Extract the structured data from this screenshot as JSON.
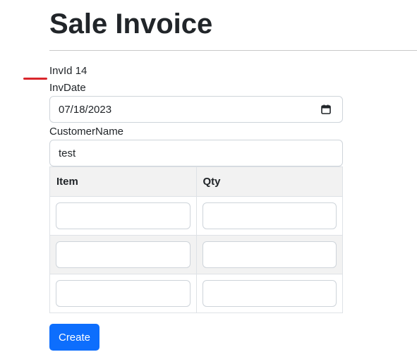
{
  "page": {
    "title": "Sale Invoice"
  },
  "invoice": {
    "invid_label": "InvId",
    "invid_value": "14",
    "invdate_label": "InvDate",
    "invdate_value": "07/18/2023",
    "customer_label": "CustomerName",
    "customer_value": "test"
  },
  "table": {
    "headers": [
      "Item",
      "Qty"
    ],
    "rows": [
      {
        "item": "",
        "qty": ""
      },
      {
        "item": "",
        "qty": ""
      },
      {
        "item": "",
        "qty": ""
      }
    ]
  },
  "actions": {
    "create_label": "Create"
  },
  "colors": {
    "primary": "#0d6efd",
    "annotation_underline": "#d9262c",
    "stripe": "#f2f2f2"
  },
  "icons": {
    "date_picker": "calendar-icon"
  }
}
